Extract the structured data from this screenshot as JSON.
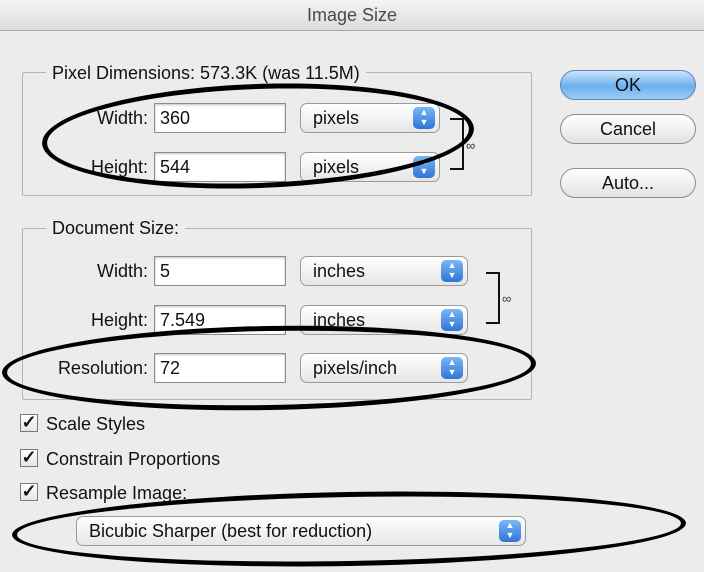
{
  "window": {
    "title": "Image Size"
  },
  "pixel_dimensions": {
    "legend": "Pixel Dimensions:  573.3K (was 11.5M)",
    "width_label": "Width:",
    "width_value": "360",
    "width_unit": "pixels",
    "height_label": "Height:",
    "height_value": "544",
    "height_unit": "pixels"
  },
  "document_size": {
    "legend": "Document Size:",
    "width_label": "Width:",
    "width_value": "5",
    "width_unit": "inches",
    "height_label": "Height:",
    "height_value": "7.549",
    "height_unit": "inches",
    "resolution_label": "Resolution:",
    "resolution_value": "72",
    "resolution_unit": "pixels/inch"
  },
  "buttons": {
    "ok": "OK",
    "cancel": "Cancel",
    "auto": "Auto..."
  },
  "options": {
    "scale_styles": {
      "label": "Scale Styles",
      "checked": true
    },
    "constrain_proportions": {
      "label": "Constrain Proportions",
      "checked": true
    },
    "resample_image": {
      "label": "Resample Image:",
      "checked": true
    }
  },
  "resample_method": "Bicubic Sharper (best for reduction)",
  "icons": {
    "checkmark": "✓",
    "stepper_up": "▲",
    "stepper_down": "▼",
    "link": "link-icon"
  },
  "colors": {
    "accent": "#6db0ef",
    "stepper": "#2f74d6",
    "annotation": "#000000"
  }
}
